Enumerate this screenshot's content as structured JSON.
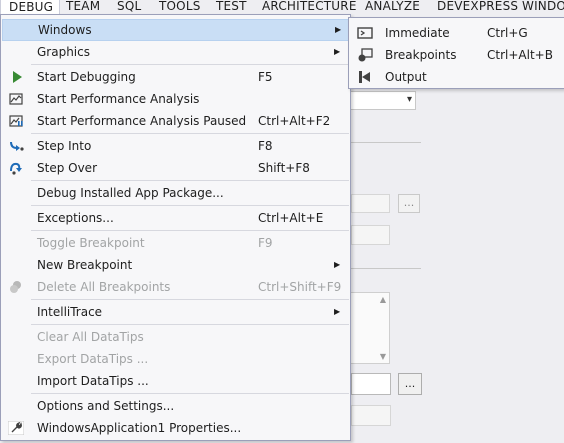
{
  "menubar": {
    "items": [
      "DEBUG",
      "TEAM",
      "SQL",
      "TOOLS",
      "TEST",
      "ARCHITECTURE",
      "ANALYZE",
      "DEVEXPRESS",
      "WINDO"
    ]
  },
  "debug_menu": {
    "items": [
      {
        "label": "Windows",
        "shortcut": "",
        "submenu": "▶",
        "icon": "none"
      },
      {
        "label": "Graphics",
        "shortcut": "",
        "submenu": "▶",
        "icon": "none"
      },
      {
        "label": "Start Debugging",
        "shortcut": "F5",
        "icon": "play-icon"
      },
      {
        "label": "Start Performance Analysis",
        "shortcut": "",
        "icon": "performance-icon"
      },
      {
        "label": "Start Performance Analysis Paused",
        "shortcut": "Ctrl+Alt+F2",
        "icon": "performance-paused-icon"
      },
      {
        "label": "Step Into",
        "shortcut": "F8",
        "icon": "step-into-icon"
      },
      {
        "label": "Step Over",
        "shortcut": "Shift+F8",
        "icon": "step-over-icon"
      },
      {
        "label": "Debug Installed App Package...",
        "shortcut": "",
        "icon": "none"
      },
      {
        "label": "Exceptions...",
        "shortcut": "Ctrl+Alt+E",
        "icon": "none"
      },
      {
        "label": "Toggle Breakpoint",
        "shortcut": "F9",
        "icon": "none",
        "disabled": true
      },
      {
        "label": "New Breakpoint",
        "shortcut": "",
        "submenu": "▶",
        "icon": "none"
      },
      {
        "label": "Delete All Breakpoints",
        "shortcut": "Ctrl+Shift+F9",
        "icon": "delete-breakpoints-icon",
        "disabled": true
      },
      {
        "label": "IntelliTrace",
        "shortcut": "",
        "submenu": "▶",
        "icon": "none"
      },
      {
        "label": "Clear All DataTips",
        "shortcut": "",
        "icon": "none",
        "disabled": true
      },
      {
        "label": "Export DataTips ...",
        "shortcut": "",
        "icon": "none",
        "disabled": true
      },
      {
        "label": "Import DataTips ...",
        "shortcut": "",
        "icon": "none"
      },
      {
        "label": "Options and Settings...",
        "shortcut": "",
        "icon": "none"
      },
      {
        "label": "WindowsApplication1 Properties...",
        "shortcut": "",
        "icon": "wrench-icon"
      }
    ]
  },
  "windows_submenu": {
    "items": [
      {
        "label": "Immediate",
        "shortcut": "Ctrl+G",
        "icon": "immediate-window-icon"
      },
      {
        "label": "Breakpoints",
        "shortcut": "Ctrl+Alt+B",
        "icon": "breakpoints-window-icon"
      },
      {
        "label": "Output",
        "shortcut": "",
        "icon": "output-window-icon"
      }
    ]
  },
  "background": {
    "dots_label": "..."
  },
  "colors": {
    "menu_bg": "#f7f7f9",
    "hover_bg": "#c9def5",
    "disabled_text": "#a2a4a5",
    "play_green": "#388a34",
    "step_blue": "#1e6bb8"
  }
}
